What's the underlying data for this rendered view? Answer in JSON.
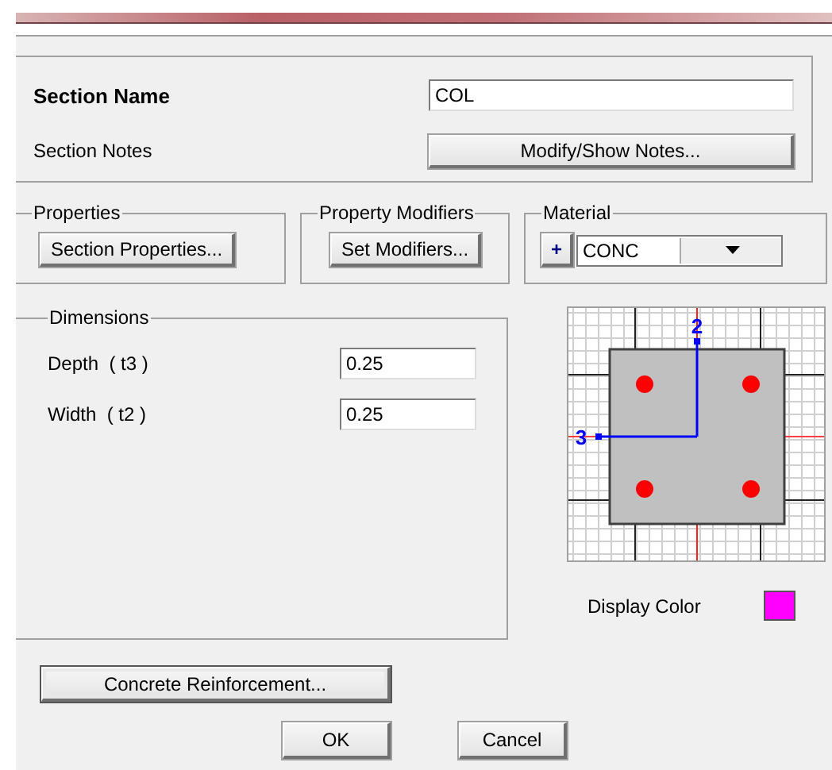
{
  "section_name": {
    "label": "Section Name",
    "value": "COL"
  },
  "section_notes": {
    "label": "Section Notes",
    "button": "Modify/Show Notes..."
  },
  "properties": {
    "title": "Properties",
    "button": "Section Properties..."
  },
  "property_modifiers": {
    "title": "Property Modifiers",
    "button": "Set Modifiers..."
  },
  "material": {
    "title": "Material",
    "add_button": "+",
    "value": "CONC"
  },
  "dimensions": {
    "title": "Dimensions",
    "fields": [
      {
        "label": "Depth  ( t3 )",
        "value": "0.25"
      },
      {
        "label": "Width  ( t2 )",
        "value": "0.25"
      }
    ]
  },
  "section_preview": {
    "axis_labels": [
      "2",
      "3"
    ]
  },
  "display_color": {
    "label": "Display Color",
    "color": "#ff00ff"
  },
  "reinforcement_button": "Concrete Reinforcement...",
  "buttons": [
    "OK",
    "Cancel"
  ]
}
